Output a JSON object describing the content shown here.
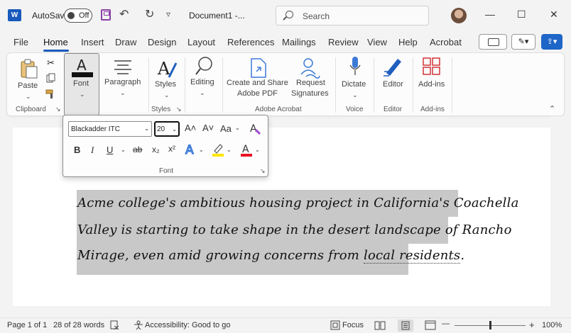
{
  "titlebar": {
    "app_letter": "W",
    "autosave_label": "AutoSave",
    "autosave_state": "Off",
    "undo_icon": "↶",
    "redo_icon": "↻",
    "qa_more_icon": "▿",
    "doc_title": "Document1  -...",
    "search_placeholder": "Search",
    "minimize": "—",
    "maximize": "☐",
    "close": "✕"
  },
  "menu": {
    "tabs": [
      "File",
      "Home",
      "Insert",
      "Draw",
      "Design",
      "Layout",
      "References",
      "Mailings",
      "Review",
      "View",
      "Help",
      "Acrobat"
    ],
    "edit_chevron": "✎▾",
    "share_icon": "⇪▾"
  },
  "ribbon": {
    "paste": "Paste",
    "font": "Font",
    "paragraph": "Paragraph",
    "styles": "Styles",
    "editing": "Editing",
    "acrobat_create": "Create and Share",
    "acrobat_pdf": "Adobe PDF",
    "request": "Request",
    "signatures": "Signatures",
    "dictate": "Dictate",
    "editor": "Editor",
    "addins": "Add-ins",
    "groups": {
      "clipboard": "Clipboard",
      "styles": "Styles",
      "adobe_acrobat": "Adobe Acrobat",
      "voice": "Voice",
      "editor": "Editor",
      "addins": "Add-ins"
    }
  },
  "font_flyout": {
    "font_name": "Blackadder ITC",
    "font_size": "20",
    "grow": "A˄",
    "shrink": "A˅",
    "change_case": "Aa",
    "bold": "B",
    "italic": "I",
    "underline": "U",
    "strike": "ab",
    "subscript": "x₂",
    "superscript": "x²",
    "label": "Font"
  },
  "document": {
    "lines": [
      "Acme college's ambitious housing project in California's Coachella",
      "Valley is starting to take shape in the desert landscape of Rancho",
      "Mirage, even amid growing concerns from "
    ],
    "underlined_tail": "local residents",
    "end_punct": "."
  },
  "status": {
    "page": "Page 1 of 1",
    "words": "28 of 28 words",
    "accessibility": "Accessibility: Good to go",
    "focus": "Focus",
    "zoom_minus": "—",
    "zoom_plus": "+",
    "zoom": "100%"
  },
  "colors": {
    "word_blue": "#185abd",
    "highlight_yellow": "#ffe600",
    "font_red": "#e81123",
    "selection_gray": "#c8c8c8"
  }
}
